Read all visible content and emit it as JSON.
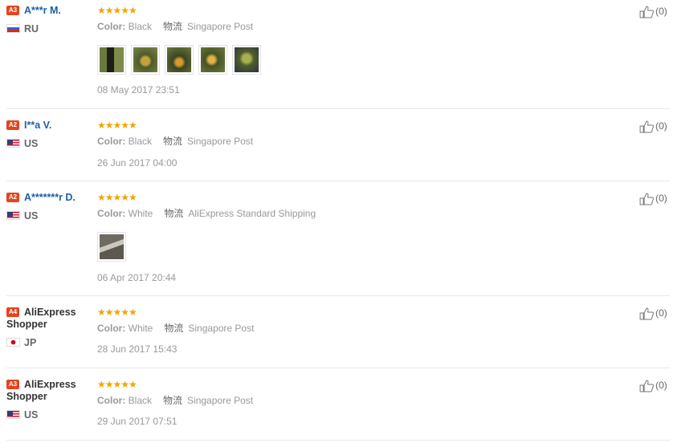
{
  "reviews": [
    {
      "badge": "A3",
      "name": "A***r M.",
      "name_style": "blue",
      "country_code": "RU",
      "country": "RU",
      "rating": 5,
      "stars": "★★★★★",
      "color_label": "Color:",
      "color_value": "Black",
      "shipping_label": "物流",
      "shipping": "Singapore Post",
      "photos": [
        "photo-1",
        "photo-2",
        "photo-3",
        "photo-4",
        "photo-5"
      ],
      "date": "08 May 2017 23:51",
      "likes": "(0)"
    },
    {
      "badge": "A2",
      "name": "I**a V.",
      "name_style": "blue",
      "country_code": "US",
      "country": "US",
      "rating": 5,
      "stars": "★★★★★",
      "color_label": "Color:",
      "color_value": "Black",
      "shipping_label": "物流",
      "shipping": "Singapore Post",
      "photos": [],
      "date": "26 Jun 2017 04:00",
      "likes": "(0)"
    },
    {
      "badge": "A2",
      "name": "A*******r D.",
      "name_style": "blue",
      "country_code": "US",
      "country": "US",
      "rating": 5,
      "stars": "★★★★★",
      "color_label": "Color:",
      "color_value": "White",
      "shipping_label": "物流",
      "shipping": "AliExpress Standard Shipping",
      "photos": [
        "photo-1"
      ],
      "date": "06 Apr 2017 20:44",
      "likes": "(0)"
    },
    {
      "badge": "A4",
      "name": "AliExpress Shopper",
      "name_style": "black",
      "country_code": "JP",
      "country": "JP",
      "rating": 5,
      "stars": "★★★★★",
      "color_label": "Color:",
      "color_value": "White",
      "shipping_label": "物流",
      "shipping": "Singapore Post",
      "photos": [],
      "date": "28 Jun 2017 15:43",
      "likes": "(0)"
    },
    {
      "badge": "A3",
      "name": "AliExpress Shopper",
      "name_style": "black",
      "country_code": "US",
      "country": "US",
      "rating": 5,
      "stars": "★★★★★",
      "color_label": "Color:",
      "color_value": "Black",
      "shipping_label": "物流",
      "shipping": "Singapore Post",
      "photos": [],
      "date": "29 Jun 2017 07:51",
      "likes": "(0)"
    }
  ],
  "colors": {
    "star": "#f2a500",
    "badge": "#e4441c",
    "link": "#1d5fa8"
  }
}
